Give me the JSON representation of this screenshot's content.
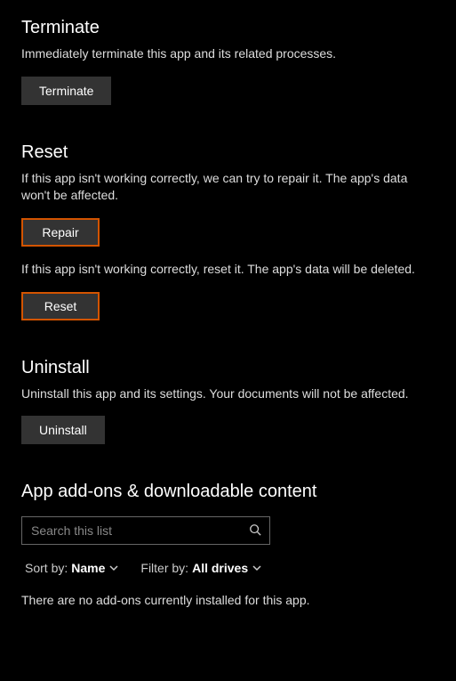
{
  "terminate": {
    "heading": "Terminate",
    "desc": "Immediately terminate this app and its related processes.",
    "button": "Terminate"
  },
  "reset": {
    "heading": "Reset",
    "repair_desc": "If this app isn't working correctly, we can try to repair it. The app's data won't be affected.",
    "repair_button": "Repair",
    "reset_desc": "If this app isn't working correctly, reset it. The app's data will be deleted.",
    "reset_button": "Reset"
  },
  "uninstall": {
    "heading": "Uninstall",
    "desc": "Uninstall this app and its settings. Your documents will not be affected.",
    "button": "Uninstall"
  },
  "addons": {
    "heading": "App add-ons & downloadable content",
    "search_placeholder": "Search this list",
    "sort_label": "Sort by:",
    "sort_value": "Name",
    "filter_label": "Filter by:",
    "filter_value": "All drives",
    "empty_message": "There are no add-ons currently installed for this app."
  },
  "colors": {
    "highlight_border": "#d35400"
  }
}
